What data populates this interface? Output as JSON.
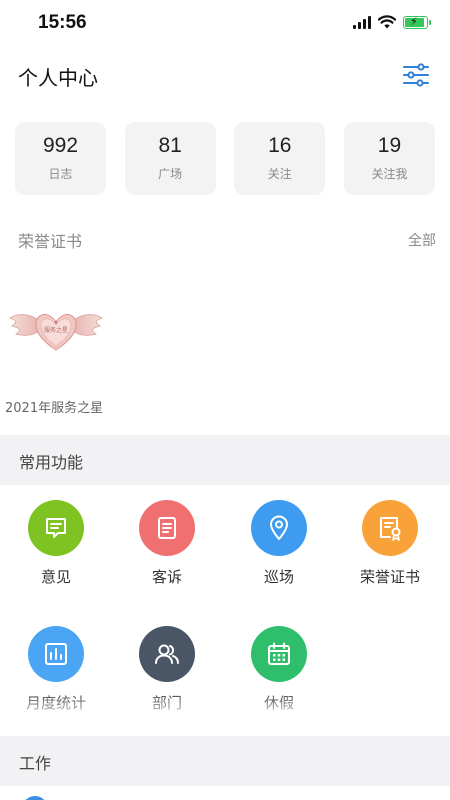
{
  "status_bar": {
    "time": "15:56"
  },
  "header": {
    "title": "个人中心",
    "filter_icon": "sliders-icon"
  },
  "stats": [
    {
      "value": "992",
      "label": "日志"
    },
    {
      "value": "81",
      "label": "广场"
    },
    {
      "value": "16",
      "label": "关注"
    },
    {
      "value": "19",
      "label": "关注我"
    }
  ],
  "honor": {
    "title": "荣誉证书",
    "all_label": "全部",
    "badge_text": "服务之星",
    "badge_caption": "2021年服务之星"
  },
  "common_functions": {
    "title": "常用功能",
    "items": [
      {
        "label": "意见",
        "icon": "message-icon",
        "color": "#7ec322"
      },
      {
        "label": "客诉",
        "icon": "checklist-icon",
        "color": "#f07072"
      },
      {
        "label": "巡场",
        "icon": "location-pin-icon",
        "color": "#3d9cf0"
      },
      {
        "label": "荣誉证书",
        "icon": "certificate-icon",
        "color": "#f9a23a"
      },
      {
        "label": "月度统计",
        "icon": "bar-chart-icon",
        "color": "#4aa6f5"
      },
      {
        "label": "部门",
        "icon": "users-icon",
        "color": "#4a5566"
      },
      {
        "label": "休假",
        "icon": "calendar-icon",
        "color": "#2fbf6c"
      }
    ]
  },
  "work": {
    "title": "工作"
  },
  "colors": {
    "accent": "#2f80d9",
    "section_bg": "#f2f2f4",
    "card_bg": "#f3f3f4"
  }
}
